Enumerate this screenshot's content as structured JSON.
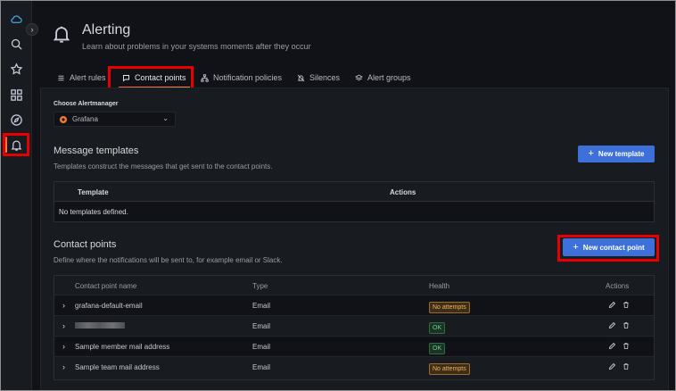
{
  "nav": {
    "items": [
      {
        "id": "home",
        "icon": "cloud-icon"
      },
      {
        "id": "search",
        "icon": "search-icon"
      },
      {
        "id": "starred",
        "icon": "star-icon"
      },
      {
        "id": "dashboards",
        "icon": "grid-icon"
      },
      {
        "id": "explore",
        "icon": "compass-icon"
      },
      {
        "id": "alerting",
        "icon": "bell-icon",
        "active": true
      }
    ],
    "expander": "›"
  },
  "header": {
    "title": "Alerting",
    "subtitle": "Learn about problems in your systems moments after they occur"
  },
  "tabs": [
    {
      "label": "Alert rules",
      "icon": "list-icon"
    },
    {
      "label": "Contact points",
      "icon": "comment-icon",
      "active": true
    },
    {
      "label": "Notification policies",
      "icon": "sitemap-icon"
    },
    {
      "label": "Silences",
      "icon": "bell-slash-icon"
    },
    {
      "label": "Alert groups",
      "icon": "layers-icon"
    }
  ],
  "alertmanager": {
    "label": "Choose Alertmanager",
    "selected": "Grafana",
    "chevron": "⌄"
  },
  "templates": {
    "title": "Message templates",
    "description": "Templates construct the messages that get sent to the contact points.",
    "new_button": "New template",
    "columns": [
      "Template",
      "Actions"
    ],
    "empty_text": "No templates defined."
  },
  "contact_points": {
    "title": "Contact points",
    "description": "Define where the notifications will be sent to, for example email or Slack.",
    "new_button": "New contact point",
    "columns": [
      "Contact point name",
      "Type",
      "Health",
      "Actions"
    ],
    "rows": [
      {
        "name": "grafana-default-email",
        "type": "Email",
        "health": "No attempts",
        "status": "warn"
      },
      {
        "name": "",
        "redacted": true,
        "type": "Email",
        "health": "OK",
        "status": "ok"
      },
      {
        "name": "Sample member mail address",
        "type": "Email",
        "health": "OK",
        "status": "ok"
      },
      {
        "name": "Sample team mail address",
        "type": "Email",
        "health": "No attempts",
        "status": "warn"
      }
    ]
  },
  "colors": {
    "background": "#111217",
    "panel": "#181b1f",
    "primary": "#3d71d9",
    "accent": "#f55f3e",
    "highlight_box": "#e80000"
  }
}
